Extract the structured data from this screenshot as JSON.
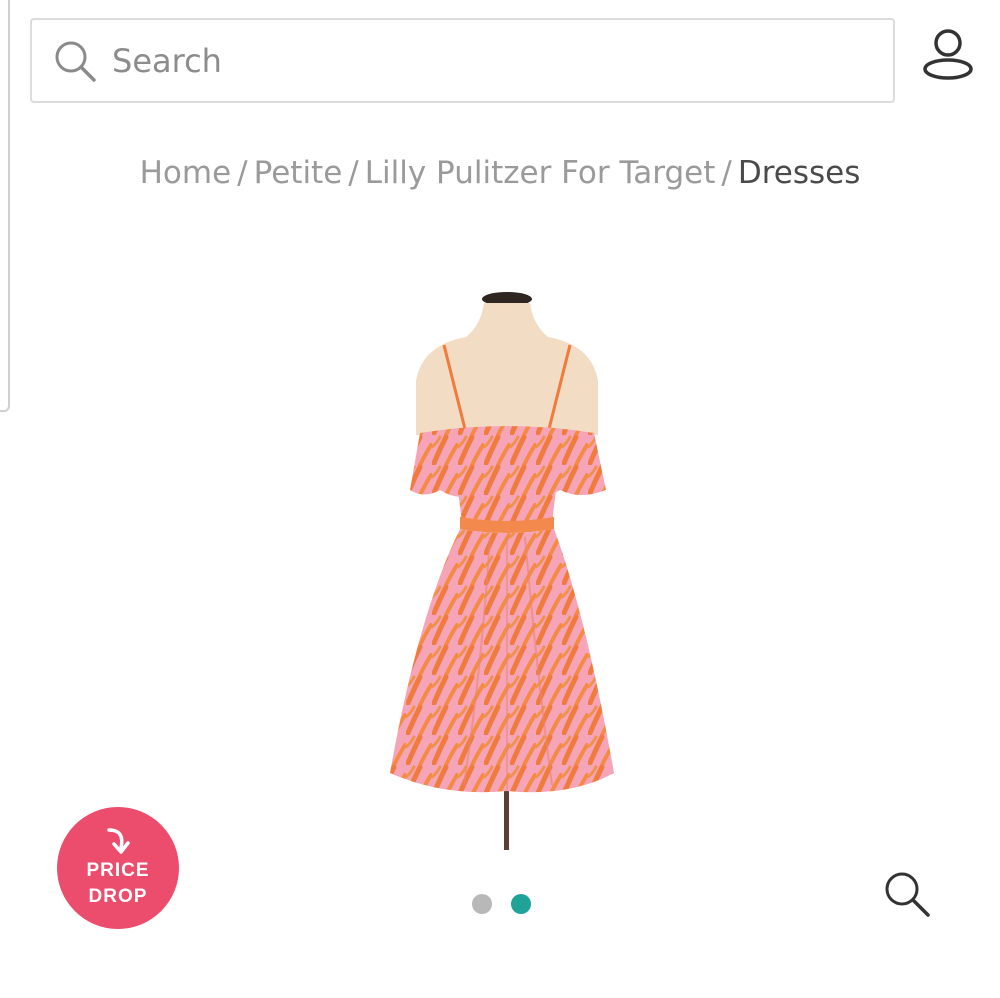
{
  "search": {
    "placeholder": "Search",
    "icon": "search-icon"
  },
  "account": {
    "icon": "user-icon"
  },
  "breadcrumb": {
    "items": [
      "Home",
      "Petite",
      "Lilly Pulitzer For Target"
    ],
    "current": "Dresses",
    "separator": "/"
  },
  "product": {
    "image": "dress-on-mannequin"
  },
  "badge": {
    "line1": "PRICE",
    "line2": "DROP",
    "color": "#ec4d6d",
    "icon": "curved-arrow-down-icon"
  },
  "carousel": {
    "total": 2,
    "active_index": 1,
    "active_color": "#1fa399",
    "inactive_color": "#b8b8b8"
  },
  "zoom": {
    "icon": "magnifier-icon"
  }
}
